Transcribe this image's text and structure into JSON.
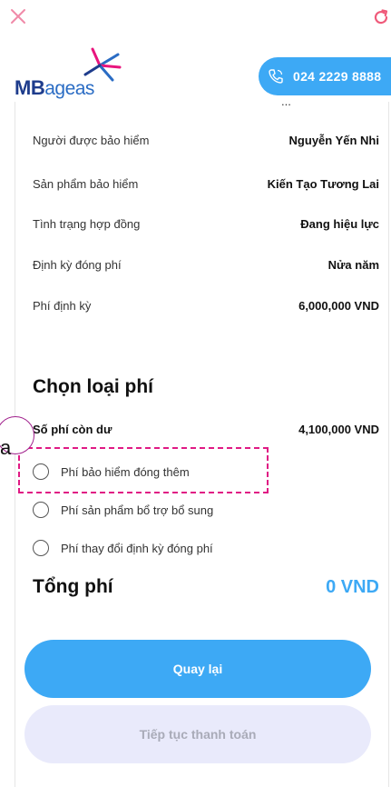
{
  "header": {
    "logo": {
      "mb": "MB",
      "ageas": "ageas"
    },
    "hotline": "024 2229 8888",
    "icons": {
      "close": "close-icon",
      "refresh": "refresh-icon",
      "phone": "phone-icon"
    }
  },
  "cut_text": "...",
  "info": [
    {
      "label": "Người được bảo hiểm",
      "value": "Nguyễn Yến Nhi"
    },
    {
      "label": "Sản phẩm bảo hiểm",
      "value": "Kiến Tạo Tương Lai"
    },
    {
      "label": "Tình trạng hợp đồng",
      "value": "Đang hiệu lực"
    },
    {
      "label": "Định kỳ đóng phí",
      "value": "Nửa năm"
    },
    {
      "label": "Phí định kỳ",
      "value": "6,000,000 VND"
    }
  ],
  "fee_section": {
    "title": "Chọn loại phí",
    "balance_label": "Số phí còn dư",
    "balance_value": "4,100,000 VND",
    "options": [
      {
        "label": "Phí bảo hiểm đóng thêm",
        "selected": false
      },
      {
        "label": "Phí sản phẩm bổ trợ bổ sung",
        "selected": false
      },
      {
        "label": "Phí thay đổi định kỳ đóng phí",
        "selected": false
      }
    ]
  },
  "annotation": {
    "label": "a"
  },
  "total": {
    "label": "Tổng phí",
    "value": "0 VND"
  },
  "buttons": {
    "back": "Quay lại",
    "continue": "Tiếp tục thanh toán"
  },
  "colors": {
    "accent": "#3da9f5",
    "annotation": "#e01a84",
    "disabled_bg": "#e9eafb"
  }
}
